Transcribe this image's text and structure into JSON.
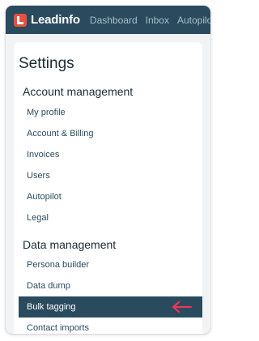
{
  "brand": {
    "name": "Leadinfo",
    "logo_color": "#e8503f"
  },
  "topbar": {
    "color": "#2a4b5e",
    "nav": [
      "Dashboard",
      "Inbox",
      "Autopilot"
    ]
  },
  "settings": {
    "title": "Settings",
    "sections": [
      {
        "title": "Account management",
        "items": [
          "My profile",
          "Account & Billing",
          "Invoices",
          "Users",
          "Autopilot",
          "Legal"
        ]
      },
      {
        "title": "Data management",
        "items": [
          "Persona builder",
          "Data dump",
          "Bulk tagging",
          "Contact imports"
        ]
      }
    ],
    "active_item": "Bulk tagging",
    "pointer_icon": "arrow-left-icon",
    "pointer_color": "#e8365a"
  }
}
